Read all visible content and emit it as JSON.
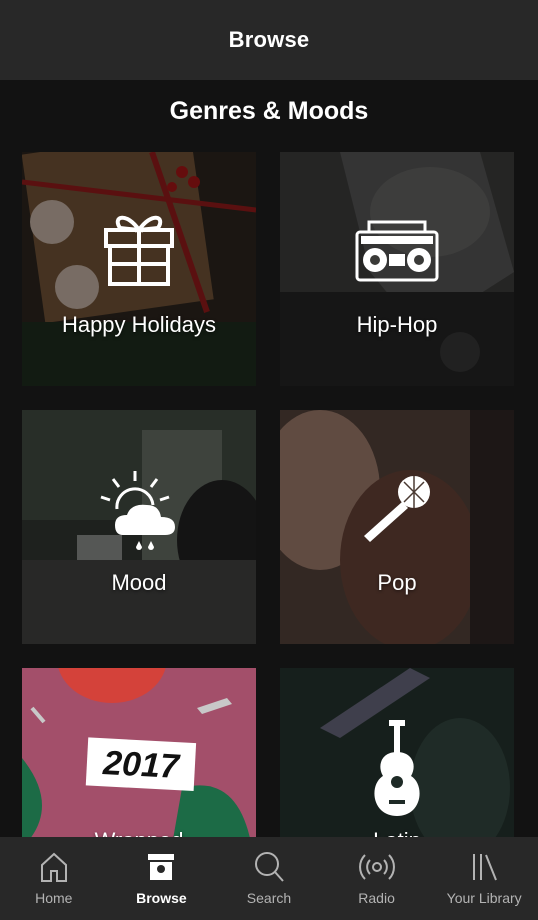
{
  "header": {
    "title": "Browse"
  },
  "section": {
    "title": "Genres & Moods"
  },
  "tiles": [
    {
      "label": "Happy Holidays",
      "icon": "gift-icon"
    },
    {
      "label": "Hip-Hop",
      "icon": "boombox-icon"
    },
    {
      "label": "Mood",
      "icon": "weather-icon"
    },
    {
      "label": "Pop",
      "icon": "microphone-icon"
    },
    {
      "label": "Wrapped",
      "icon": "",
      "badge": "2017"
    },
    {
      "label": "Latin",
      "icon": "guitar-icon"
    }
  ],
  "nav": [
    {
      "label": "Home",
      "icon": "home-icon",
      "active": false
    },
    {
      "label": "Browse",
      "icon": "browse-icon",
      "active": true
    },
    {
      "label": "Search",
      "icon": "search-icon",
      "active": false
    },
    {
      "label": "Radio",
      "icon": "radio-icon",
      "active": false
    },
    {
      "label": "Your Library",
      "icon": "library-icon",
      "active": false
    }
  ],
  "colors": {
    "background": "#121212",
    "header": "#282828",
    "nav": "#282828",
    "text": "#ffffff",
    "inactive": "#b3b3b3"
  }
}
